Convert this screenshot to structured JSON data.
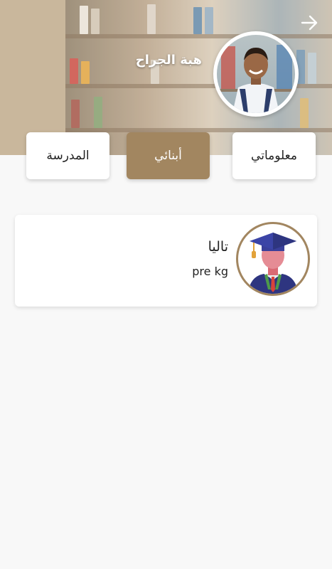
{
  "header": {
    "user_name": "هبة الجراح",
    "back_icon": "arrow-right-icon",
    "colors": {
      "accent": "#a28660",
      "header_bg": "#c9b79c"
    }
  },
  "tabs": [
    {
      "label": "المدرسة",
      "active": false
    },
    {
      "label": "أبنائي",
      "active": true
    },
    {
      "label": "معلوماتي",
      "active": false
    }
  ],
  "children": [
    {
      "name": "تاليا",
      "grade": "pre kg",
      "avatar_icon": "graduate-avatar-icon"
    }
  ]
}
